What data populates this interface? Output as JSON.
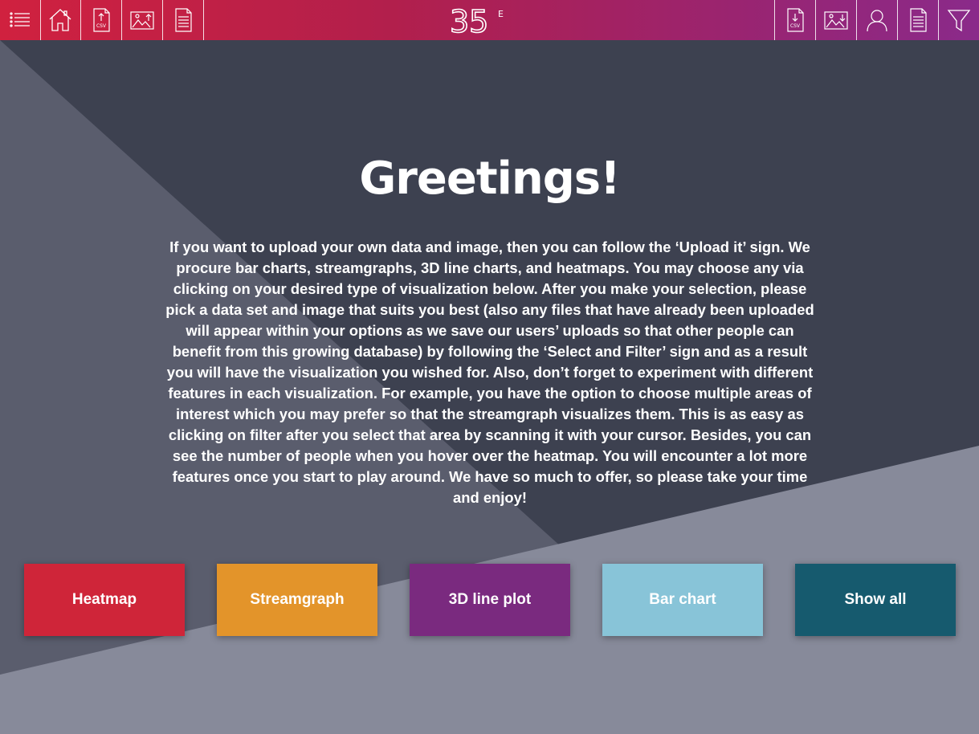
{
  "theme": {
    "bg_dark": "#3d4150",
    "bg_mid": "#5a5d6d",
    "bg_light": "#878a9a"
  },
  "topbar": {
    "logo_text": "35",
    "logo_superscript": "E",
    "left_icons": [
      "menu-icon",
      "home-icon",
      "upload-csv-icon",
      "upload-image-icon",
      "document-icon"
    ],
    "right_icons": [
      "download-csv-icon",
      "download-image-icon",
      "user-icon",
      "document-icon",
      "filter-icon"
    ],
    "csv_label": "CSV"
  },
  "main": {
    "title": "Greetings!",
    "intro": "If you want to upload your own data and image, then you can follow the ‘Upload it’ sign. We procure bar charts, streamgraphs, 3D line charts, and heatmaps. You may choose any via clicking on your desired type of visualization below. After you make your selection, please pick a data set and image that suits you best (also any files that have already been uploaded will appear within your options as we save our users’ uploads so that other people can benefit from this growing database) by following the ‘Select and Filter’ sign and as a result you will have the visualization you wished for. Also, don’t forget to experiment with different features in each visualization. For example, you have the option to choose multiple areas of interest which you may prefer so that the streamgraph visualizes them. This is as easy as clicking on filter after you select that area by scanning it with your cursor. Besides, you can see the number of people when you hover over the heatmap. You will encounter a lot more features once you start to play around. We have so much to offer, so please take your time and enjoy!"
  },
  "buttons": [
    {
      "label": "Heatmap",
      "color": "#cf2539"
    },
    {
      "label": "Streamgraph",
      "color": "#e3942a"
    },
    {
      "label": "3D line plot",
      "color": "#7a2a7f"
    },
    {
      "label": "Bar chart",
      "color": "#88c4d8"
    },
    {
      "label": "Show all",
      "color": "#165a6e"
    }
  ]
}
